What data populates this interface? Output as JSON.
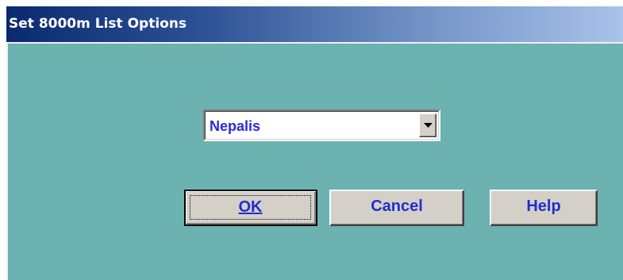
{
  "window": {
    "title": "Set 8000m List Options"
  },
  "dropdown": {
    "selected_value": "Nepalis"
  },
  "buttons": {
    "ok_label": "OK",
    "cancel_label": "Cancel",
    "help_label": "Help"
  },
  "colors": {
    "client_background": "#6bb2b1",
    "text_accent": "#2b2bd6",
    "button_face": "#d4d0c8"
  },
  "icons": {
    "dropdown_arrow": "chevron-down-icon"
  }
}
